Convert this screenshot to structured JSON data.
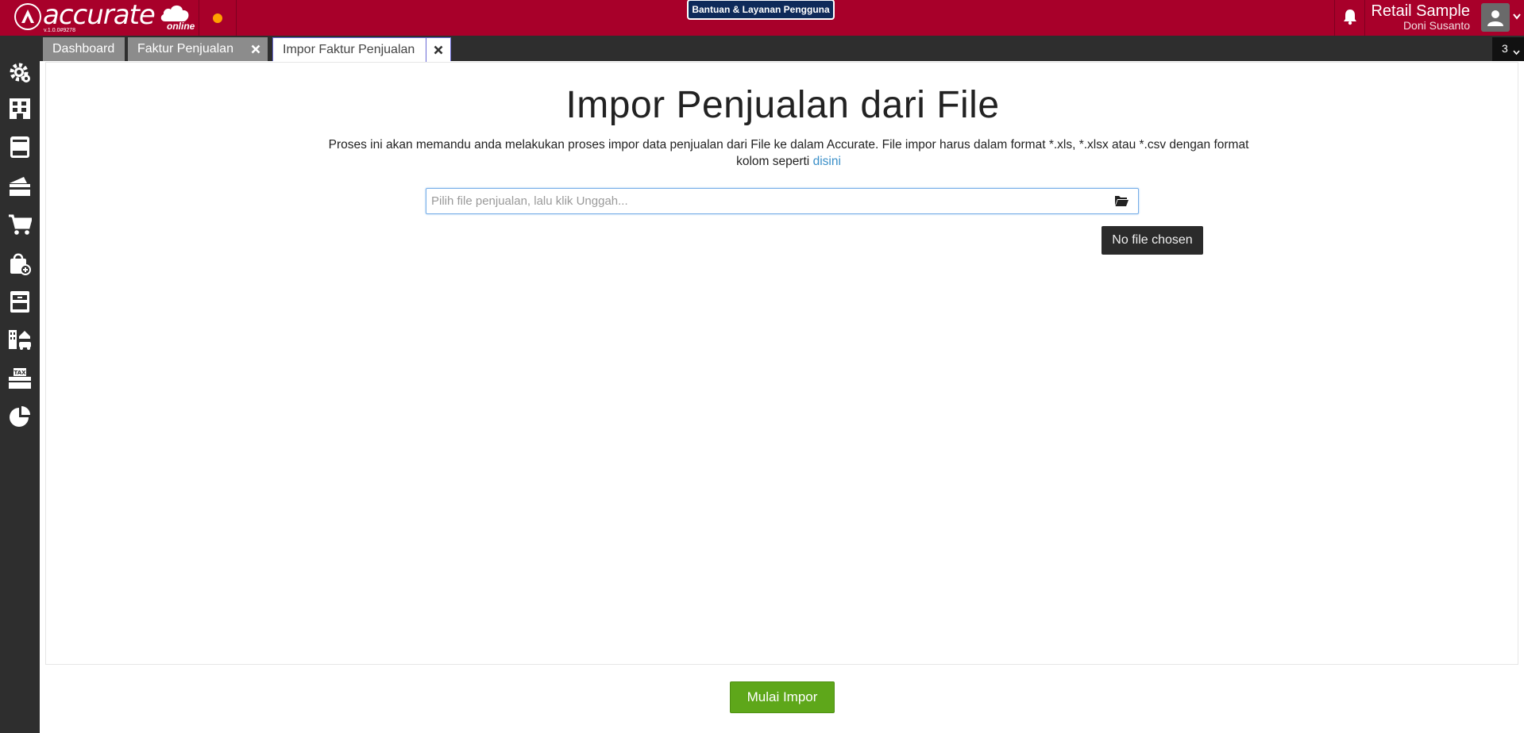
{
  "app": {
    "logo_text": "accurate",
    "logo_sub": "online",
    "version": "v.1.0.0#9278",
    "help_button": "Bantuan & Layanan Pengguna",
    "company_name": "Retail Sample",
    "user_name": "Doni Susanto",
    "brand_color": "#a8002a"
  },
  "tabs": [
    {
      "label": "Dashboard"
    },
    {
      "label": "Faktur Penjualan"
    },
    {
      "label": "Impor Faktur Penjualan"
    }
  ],
  "tab_count": "3",
  "sidebar": {
    "icons": [
      "settings-icon",
      "company-icon",
      "ledger-icon",
      "bank-icon",
      "cart-icon",
      "shopping-bag-icon",
      "inventory-icon",
      "assets-icon",
      "tax-icon",
      "report-icon"
    ]
  },
  "main": {
    "title": "Impor Penjualan dari File",
    "description": "Proses ini akan memandu anda melakukan proses impor data penjualan dari File ke dalam Accurate. File impor harus dalam format *.xls, *.xlsx atau *.csv dengan format kolom seperti",
    "link_text": "disini",
    "file_placeholder": "Pilih file penjualan, lalu klik Unggah...",
    "file_tooltip": "No file chosen",
    "start_button": "Mulai Impor"
  }
}
